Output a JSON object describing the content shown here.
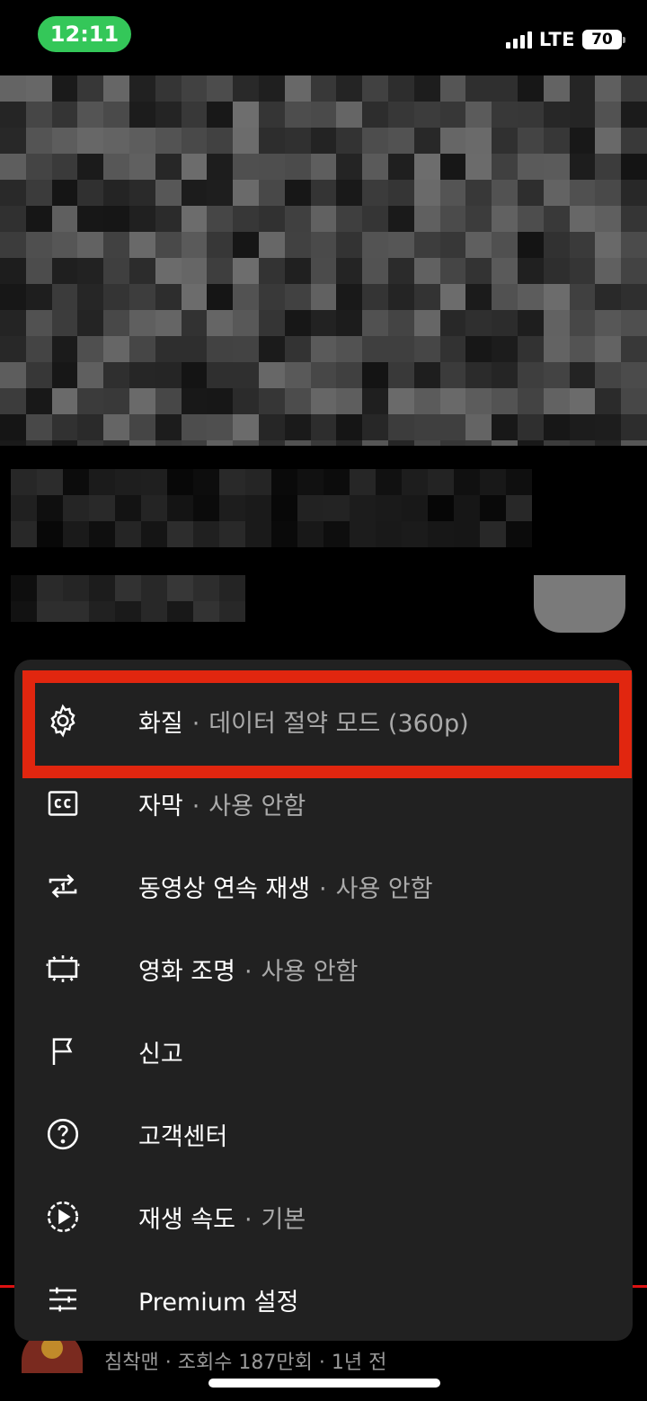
{
  "status_bar": {
    "time": "12:11",
    "network": "LTE",
    "battery": "70",
    "accent_color": "#34c759"
  },
  "menu": {
    "items": [
      {
        "label": "화질",
        "value": "데이터 절약 모드 (360p)",
        "icon": "gear-icon"
      },
      {
        "label": "자막",
        "value": "사용 안함",
        "icon": "captions-icon"
      },
      {
        "label": "동영상 연속 재생",
        "value": "사용 안함",
        "icon": "repeat-one-icon"
      },
      {
        "label": "영화 조명",
        "value": "사용 안함",
        "icon": "ambient-mode-icon"
      },
      {
        "label": "신고",
        "value": "",
        "icon": "flag-icon"
      },
      {
        "label": "고객센터",
        "value": "",
        "icon": "help-icon"
      },
      {
        "label": "재생 속도",
        "value": "기본",
        "icon": "playback-speed-icon"
      },
      {
        "label": "Premium 설정",
        "value": "",
        "icon": "sliders-icon"
      }
    ],
    "highlight_color": "#e1260f"
  },
  "footer": {
    "meta": "침착맨 · 조회수 187만회 · 1년 전"
  }
}
